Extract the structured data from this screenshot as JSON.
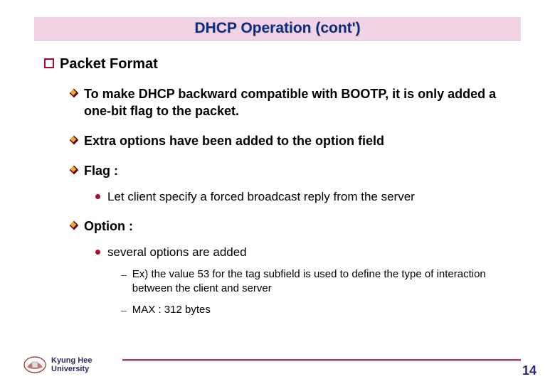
{
  "title": "DHCP Operation (cont')",
  "lvl1": {
    "text": "Packet Format"
  },
  "lvl2_a": "To make DHCP backward compatible with BOOTP, it is only added a one-bit flag to the packet.",
  "lvl2_b": "Extra options have been added to the option field",
  "lvl2_c": "Flag :",
  "lvl2_d": "Option :",
  "lvl3_a": "Let client specify a forced broadcast reply from the server",
  "lvl3_b": "several options are added",
  "lvl4_a": "Ex) the value 53 for the tag subfield is used to define the type of interaction between the client and server",
  "lvl4_b": "MAX : 312  bytes",
  "footer": {
    "line1": "Kyung Hee",
    "line2": "University"
  },
  "page_number": "14"
}
